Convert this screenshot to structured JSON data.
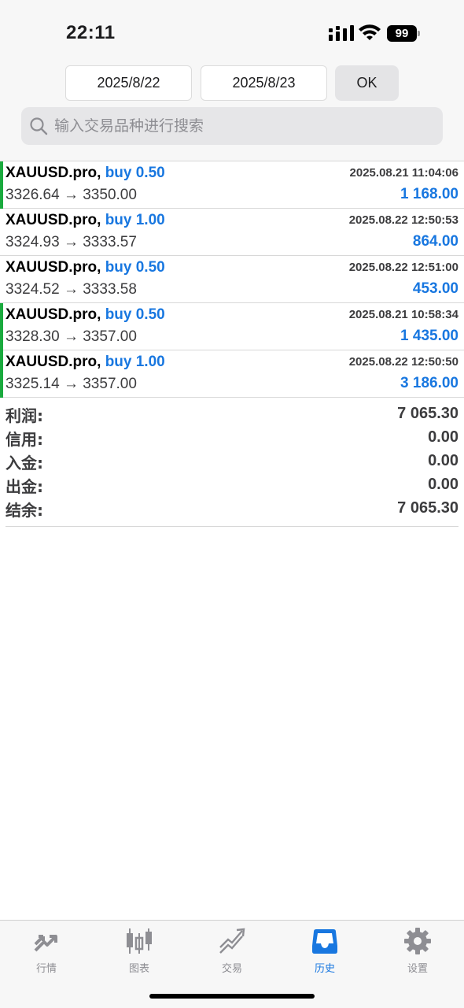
{
  "status_bar": {
    "time": "22:11",
    "battery": "99"
  },
  "filter": {
    "date_from": "2025/8/22",
    "date_to": "2025/8/23",
    "ok_label": "OK",
    "search_placeholder": "输入交易品种进行搜索"
  },
  "deals": [
    {
      "symbol": "XAUUSD.pro,",
      "type": "buy 0.50",
      "prices": "3326.64 → 3350.00",
      "time": "2025.08.21 11:04:06",
      "profit": "1 168.00",
      "marked": true
    },
    {
      "symbol": "XAUUSD.pro,",
      "type": "buy 1.00",
      "prices": "3324.93 → 3333.57",
      "time": "2025.08.22 12:50:53",
      "profit": "864.00",
      "marked": false
    },
    {
      "symbol": "XAUUSD.pro,",
      "type": "buy 0.50",
      "prices": "3324.52 → 3333.58",
      "time": "2025.08.22 12:51:00",
      "profit": "453.00",
      "marked": false
    },
    {
      "symbol": "XAUUSD.pro,",
      "type": "buy 0.50",
      "prices": "3328.30 → 3357.00",
      "time": "2025.08.21 10:58:34",
      "profit": "1 435.00",
      "marked": true
    },
    {
      "symbol": "XAUUSD.pro,",
      "type": "buy 1.00",
      "prices": "3325.14 → 3357.00",
      "time": "2025.08.22 12:50:50",
      "profit": "3 186.00",
      "marked": true
    }
  ],
  "summary": [
    {
      "label": "利润:",
      "value": "7 065.30"
    },
    {
      "label": "信用:",
      "value": "0.00"
    },
    {
      "label": "入金:",
      "value": "0.00"
    },
    {
      "label": "出金:",
      "value": "0.00"
    },
    {
      "label": "结余:",
      "value": "7 065.30"
    }
  ],
  "tabs": [
    {
      "label": "行情",
      "icon": "quotes-arrows-icon",
      "active": false
    },
    {
      "label": "图表",
      "icon": "candlestick-chart-icon",
      "active": false
    },
    {
      "label": "交易",
      "icon": "trade-trend-icon",
      "active": false
    },
    {
      "label": "历史",
      "icon": "history-inbox-icon",
      "active": true
    },
    {
      "label": "设置",
      "icon": "gear-icon",
      "active": false
    }
  ],
  "colors": {
    "accent": "#1877e0",
    "marker_green": "#1aaa3e",
    "inactive": "#8e8e93"
  }
}
